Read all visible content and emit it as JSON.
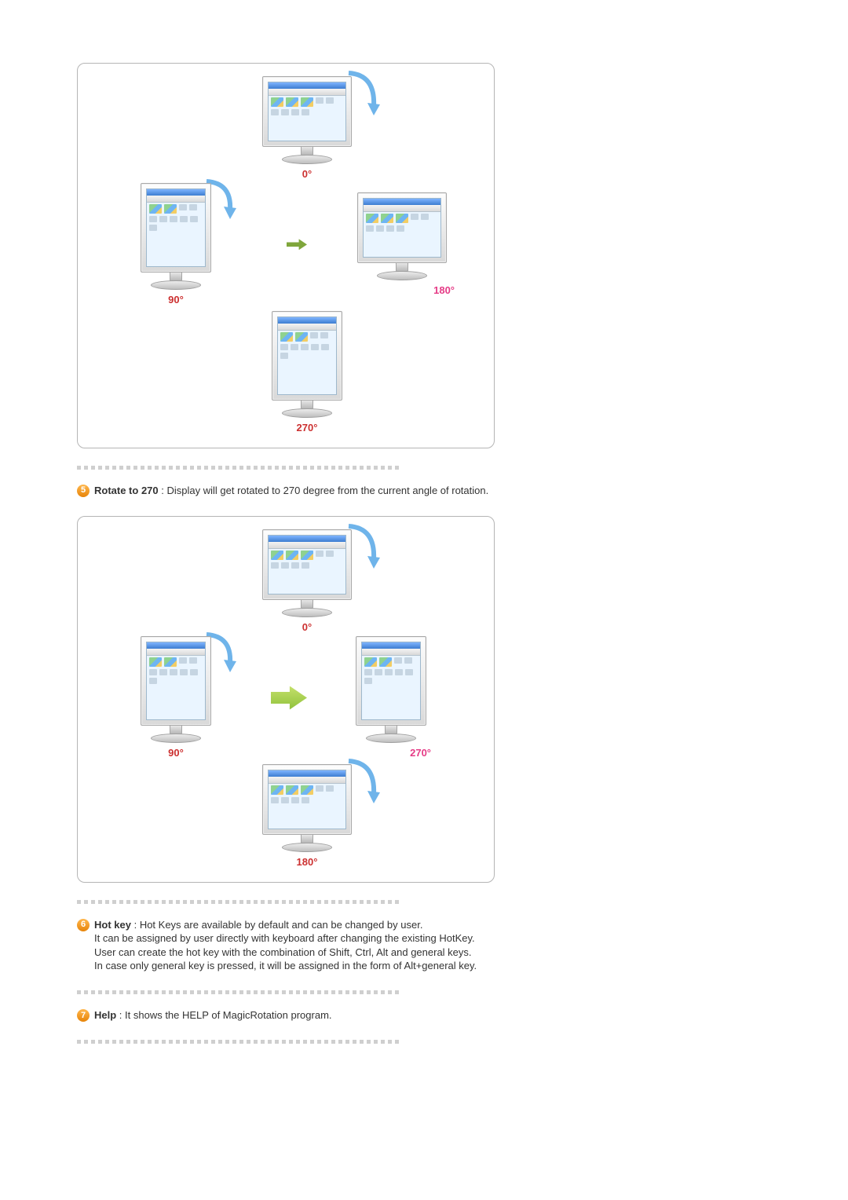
{
  "figure180": {
    "angles": {
      "a0": "0°",
      "a90": "90°",
      "a180": "180°",
      "a270": "270°"
    }
  },
  "item5": {
    "number": "5",
    "title": "Rotate to 270",
    "desc": ": Display will get rotated to 270 degree from the current angle of rotation."
  },
  "figure270": {
    "angles": {
      "a0": "0°",
      "a90": "90°",
      "a180": "180°",
      "a270": "270°"
    }
  },
  "item6": {
    "number": "6",
    "title": "Hot key",
    "line1": ": Hot Keys are available by default and can be changed by user.",
    "line2": "It can be assigned by user directly with keyboard after changing the existing HotKey.",
    "line3": "User can create the hot key with the combination of Shift, Ctrl, Alt and general keys.",
    "line4": "In case only general key is pressed, it will be assigned in the form of Alt+general key."
  },
  "item7": {
    "number": "7",
    "title": "Help",
    "desc": ": It shows the HELP of MagicRotation program."
  }
}
